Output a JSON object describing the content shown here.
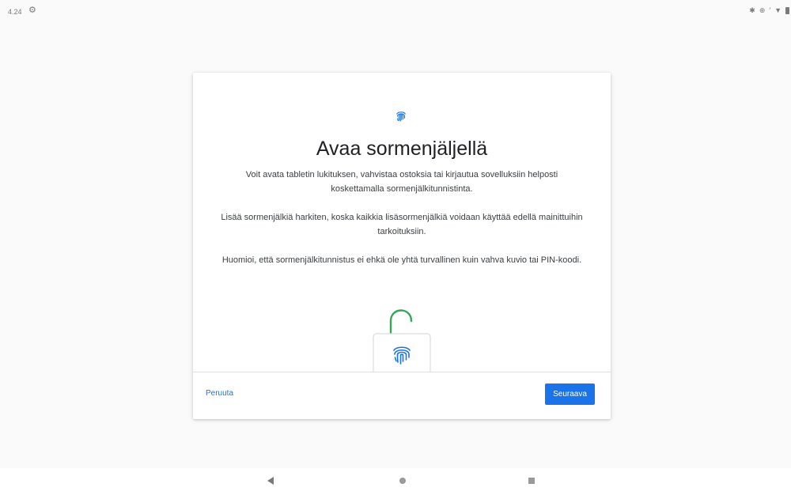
{
  "status_bar": {
    "time": "4.24",
    "icons": [
      "settings-gear-icon",
      "bluetooth-icon",
      "data-saver-icon",
      "vibrate-icon",
      "wifi-icon",
      "battery-icon"
    ]
  },
  "dialog": {
    "header_icon": "fingerprint-icon",
    "title": "Avaa sormenjäljellä",
    "paragraphs": [
      "Voit avata tabletin lukituksen, vahvistaa ostoksia tai kirjautua sovelluksiin helposti koskettamalla sormenjälkitunnistinta.",
      "Lisää sormenjälkiä harkiten, koska kaikkia lisäsormenjälkiä voidaan käyttää edellä mainittuihin tarkoituksiin.",
      "Huomioi, että sormenjälkitunnistus ei ehkä ole yhtä turvallinen kuin vahva kuvio tai PIN-koodi."
    ],
    "illustration": "unlocked-padlock-fingerprint-illustration",
    "cancel_label": "Peruuta",
    "next_label": "Seuraava"
  },
  "nav_bar": {
    "buttons": [
      "back-icon",
      "home-icon",
      "recents-icon"
    ]
  },
  "colors": {
    "accent": "#1a73e8",
    "padlock_shackle": "#34a853",
    "fingerprint": "#1a73e8",
    "background": "#fafafa"
  }
}
